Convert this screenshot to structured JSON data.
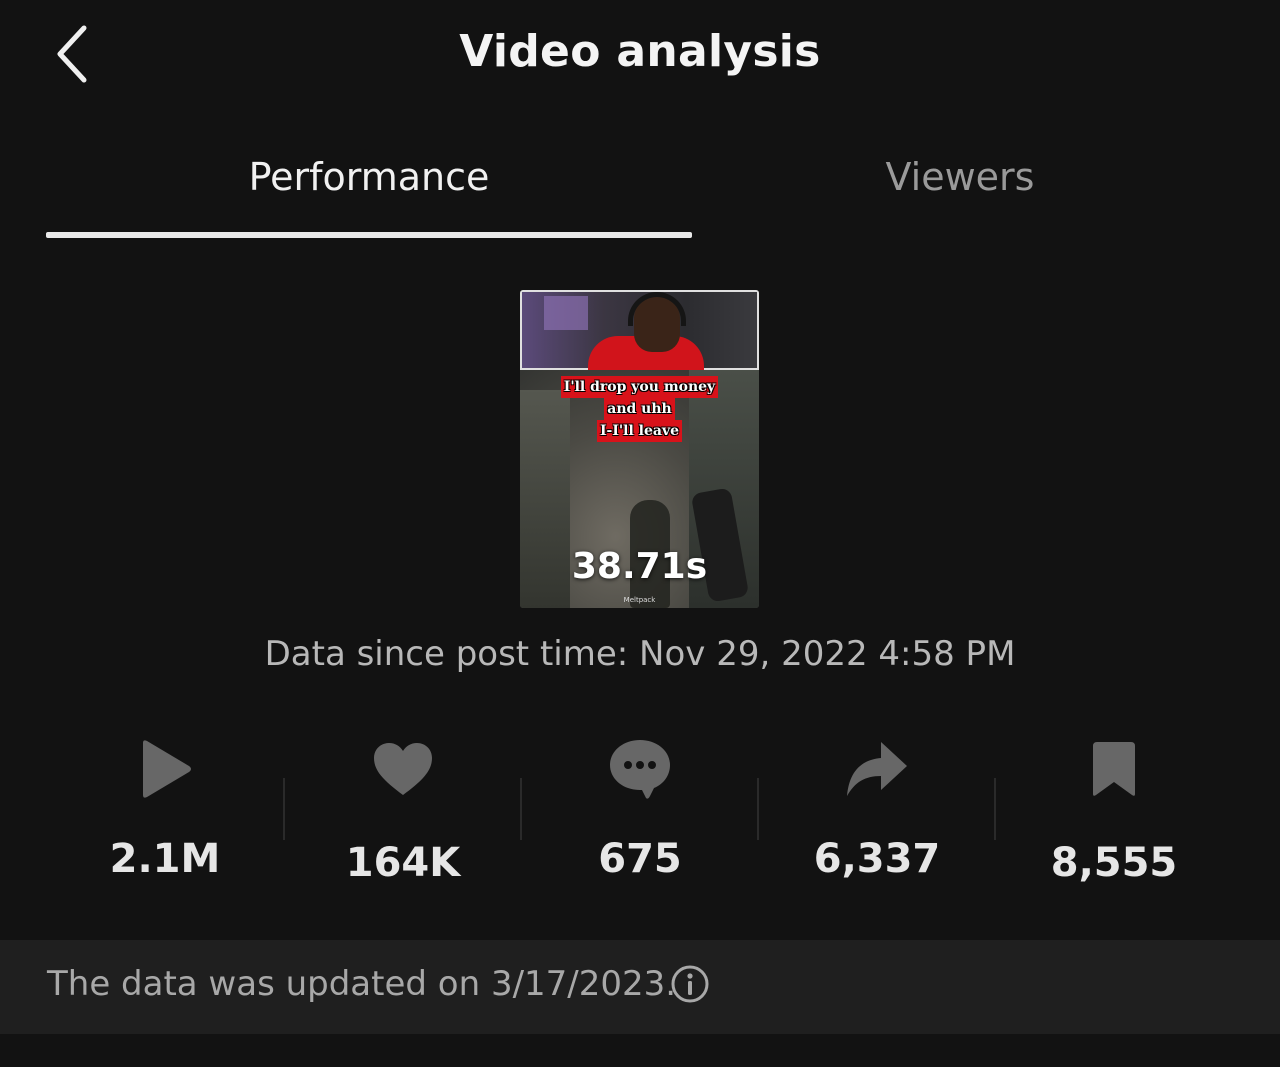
{
  "header": {
    "title": "Video analysis",
    "back_icon": "chevron-left-icon"
  },
  "tabs": [
    {
      "label": "Performance",
      "active": true
    },
    {
      "label": "Viewers",
      "active": false
    }
  ],
  "video": {
    "duration": "38.71s",
    "caption_lines": [
      "I'll drop you money",
      "and uhh",
      "I-I'll leave"
    ],
    "watermark": "Meltpack"
  },
  "post_time": "Data since post time: Nov 29, 2022 4:58 PM",
  "stats": [
    {
      "icon": "play-icon",
      "value": "2.1M"
    },
    {
      "icon": "heart-icon",
      "value": "164K"
    },
    {
      "icon": "comment-icon",
      "value": "675"
    },
    {
      "icon": "share-icon",
      "value": "6,337"
    },
    {
      "icon": "bookmark-icon",
      "value": "8,555"
    }
  ],
  "footer": {
    "text": "The data was updated on 3/17/2023.",
    "info_icon": "info-icon"
  },
  "colors": {
    "background": "#121212",
    "footer_background": "#1f1f1f",
    "icon_gray": "#666666",
    "caption_red": "#d8121a"
  }
}
